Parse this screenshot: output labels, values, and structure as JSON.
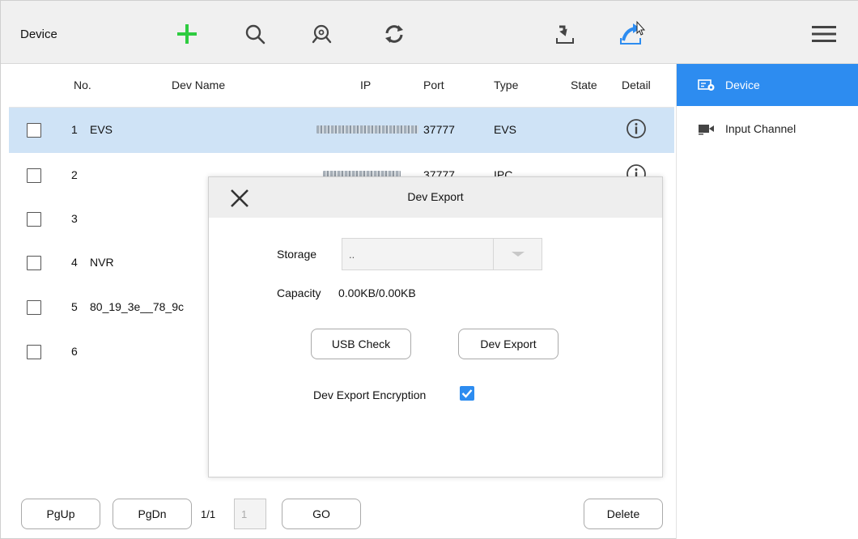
{
  "toolbar": {
    "title": "Device",
    "icons": [
      "add-icon",
      "search-icon",
      "auto-search-icon",
      "refresh-icon",
      "import-icon",
      "export-icon",
      "menu-icon"
    ]
  },
  "table": {
    "headers": {
      "no": "No.",
      "dev_name": "Dev Name",
      "ip": "IP",
      "port": "Port",
      "type": "Type",
      "state": "State",
      "detail": "Detail"
    },
    "rows": [
      {
        "no": "1",
        "name": "EVS",
        "port": "37777",
        "type": "EVS",
        "selected": true
      },
      {
        "no": "2",
        "name": "",
        "port": "37777",
        "type": "IPC",
        "selected": false
      },
      {
        "no": "3",
        "name": "",
        "port": "",
        "type": "",
        "selected": false
      },
      {
        "no": "4",
        "name": "NVR",
        "port": "",
        "type": "",
        "selected": false
      },
      {
        "no": "5",
        "name": "80_19_3e__78_9c",
        "port": "",
        "type": "",
        "selected": false
      },
      {
        "no": "6",
        "name": "",
        "port": "",
        "type": "",
        "selected": false
      }
    ]
  },
  "sidebar": {
    "items": [
      {
        "label": "Device",
        "active": true
      },
      {
        "label": "Input Channel",
        "active": false
      }
    ]
  },
  "footer": {
    "pgup": "PgUp",
    "pgdn": "PgDn",
    "page_info": "1/1",
    "page_input": "1",
    "go": "GO",
    "delete": "Delete"
  },
  "modal": {
    "title": "Dev Export",
    "storage_label": "Storage",
    "storage_value": "..",
    "capacity_label": "Capacity",
    "capacity_value": "0.00KB/0.00KB",
    "usb_check": "USB Check",
    "dev_export": "Dev Export",
    "encryption_label": "Dev Export Encryption",
    "encryption_checked": true
  },
  "colors": {
    "accent": "#2d8cf0",
    "selected_row": "#cfe3f6",
    "add_icon": "#2ecc40"
  }
}
